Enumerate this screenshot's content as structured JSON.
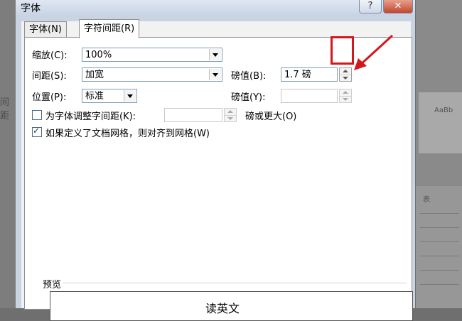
{
  "background": {
    "left_fragment": "间距",
    "right_fragment_1": "AaBb",
    "right_fragment_2": "表"
  },
  "dialog": {
    "title": "字体",
    "help_label": "?",
    "close_label": "✕",
    "tabs": [
      {
        "label": "字体(N)"
      },
      {
        "label": "字符间距(R)"
      }
    ]
  },
  "spacing": {
    "scale_label": "缩放(C):",
    "scale_value": "100%",
    "spacing_label": "间距(S):",
    "spacing_value": "加宽",
    "spacing_pt_label": "磅值(B):",
    "spacing_pt_value": "1.7 磅",
    "position_label": "位置(P):",
    "position_value": "标准",
    "position_pt_label": "磅值(Y):",
    "position_pt_value": "",
    "kerning_label": "为字体调整字间距(K):",
    "kerning_value": "",
    "kerning_suffix": "磅或更大(O)",
    "grid_label": "如果定义了文档网格，则对齐到网格(W)",
    "kerning_checked": false,
    "grid_checked": true
  },
  "preview": {
    "label": "预览",
    "text": "读英文"
  },
  "colors": {
    "highlight": "#d4171a"
  }
}
